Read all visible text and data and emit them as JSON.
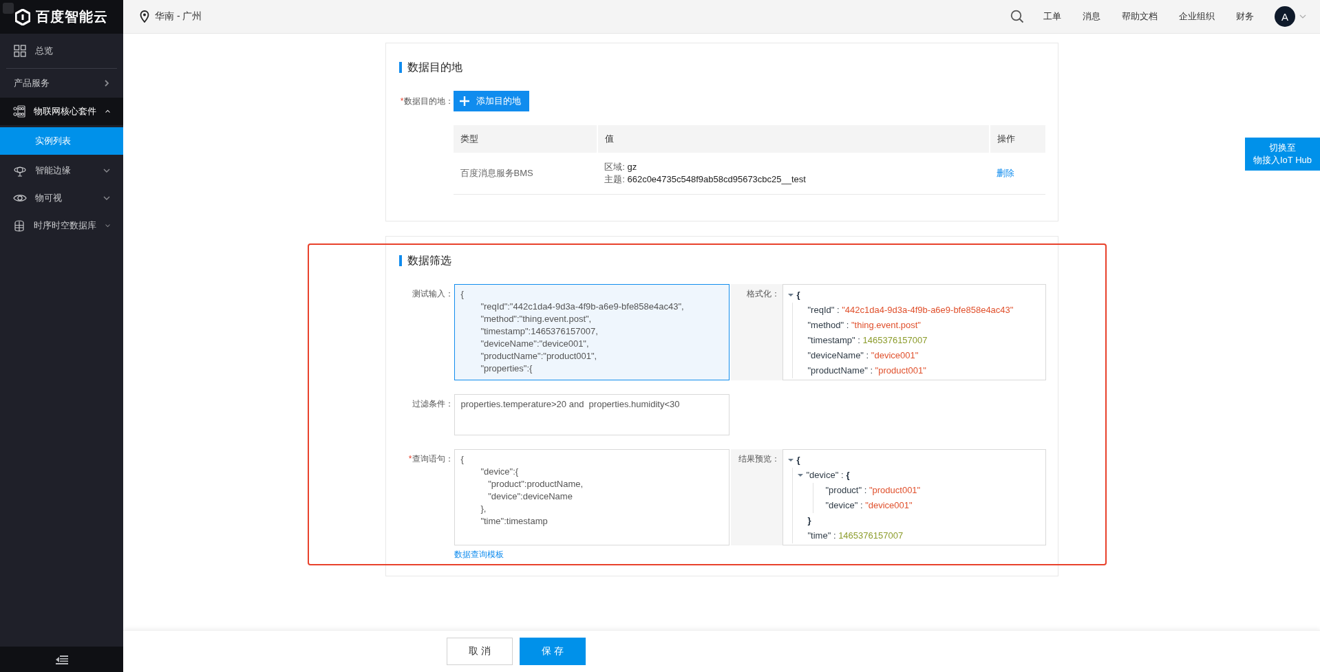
{
  "sidebar": {
    "logo": "百度智能云",
    "items": [
      {
        "kind": "link",
        "label": "总览"
      },
      {
        "kind": "category",
        "label": "产品服务"
      },
      {
        "kind": "group",
        "label": "物联网核心套件",
        "expanded": true,
        "children": [
          {
            "kind": "subitem",
            "label": "实例列表",
            "selected": true
          }
        ]
      },
      {
        "kind": "group",
        "label": "智能边缘",
        "expanded": false
      },
      {
        "kind": "group",
        "label": "物可视",
        "expanded": false
      },
      {
        "kind": "group",
        "label": "时序时空数据库",
        "expanded": false
      }
    ]
  },
  "top_bar": {
    "region": "华南 - 广州",
    "nav_links": [
      "工单",
      "消息",
      "帮助文档",
      "企业组织",
      "财务"
    ],
    "avatar": "A"
  },
  "destination_card": {
    "title": "数据目的地",
    "required_mark": "*",
    "field_label": "数据目的地：",
    "add_button": "添加目的地",
    "table": {
      "columns": [
        "类型",
        "值",
        "操作"
      ],
      "rows": [
        {
          "type": "百度消息服务BMS",
          "values": [
            {
              "label": "区域:",
              "text": "gz"
            },
            {
              "label": "主题:",
              "text": "662c0e4735c548f9ab58cd95673cbc25__test"
            }
          ],
          "action": "删除"
        }
      ]
    }
  },
  "filter_card": {
    "title": "数据筛选",
    "rows": [
      {
        "label": "测试输入：",
        "input": {
          "value": "{\n        \"reqId\":\"442c1da4-9d3a-4f9b-a6e9-bfe858e4ac43\",\n        \"method\":\"thing.event.post\",\n        \"timestamp\":1465376157007,\n        \"deviceName\":\"device001\",\n        \"productName\":\"product001\",\n        \"properties\":{",
          "focused": true
        },
        "preview": {
          "label": "格式化：",
          "tree": {
            "open": "{",
            "expanded": true,
            "children": [
              {
                "kind": "string",
                "key": "\"reqId\" :",
                "value": "\"442c1da4-9d3a-4f9b-a6e9-bfe858e4ac43\""
              },
              {
                "kind": "string",
                "key": "\"method\" :",
                "value": "\"thing.event.post\""
              },
              {
                "kind": "number",
                "key": "\"timestamp\" :",
                "value": "1465376157007"
              },
              {
                "kind": "string",
                "key": "\"deviceName\" :",
                "value": "\"device001\""
              },
              {
                "kind": "string",
                "key": "\"productName\" :",
                "value": "\"product001\""
              }
            ]
          }
        }
      },
      {
        "label": "过滤条件：",
        "input": {
          "value": "properties.temperature>20 and  properties.humidity<30",
          "focused": false
        }
      },
      {
        "required_mark": "*",
        "label": "查询语句：",
        "input": {
          "value": "{\n        \"device\":{\n           \"product\":productName,\n           \"device\":deviceName\n        },\n        \"time\":timestamp",
          "focused": false
        },
        "link": "数据查询模板",
        "preview": {
          "label": "结果预览：",
          "tree": {
            "open": "{",
            "expanded": true,
            "children": [
              {
                "kind": "object",
                "key": "\"device\" :",
                "open": "{",
                "close": "}",
                "expanded": true,
                "children": [
                  {
                    "kind": "string",
                    "key": "\"product\" :",
                    "value": "\"product001\""
                  },
                  {
                    "kind": "string",
                    "key": "\"device\" :",
                    "value": "\"device001\""
                  }
                ]
              },
              {
                "kind": "number",
                "key": "\"time\" :",
                "value": "1465376157007"
              }
            ]
          }
        }
      }
    ]
  },
  "switch_button": {
    "lines": [
      "切换至",
      "物接入IoT Hub"
    ]
  },
  "footer": {
    "buttons": [
      {
        "kind": "secondary",
        "label": "取 消"
      },
      {
        "kind": "primary",
        "label": "保 存"
      }
    ]
  }
}
